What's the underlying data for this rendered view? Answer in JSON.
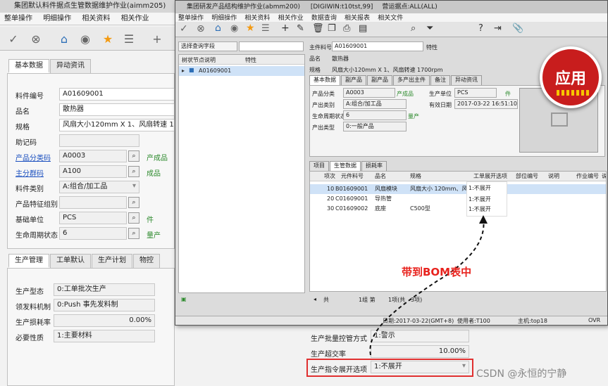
{
  "back": {
    "title": "集团默认料件据点生管数据维护作业(aimm205)",
    "menu": [
      "整单操作",
      "明细操作",
      "相关资料",
      "相关作业"
    ],
    "tabs": [
      "基本数据",
      "异动资讯"
    ],
    "fields": [
      {
        "label": "料件编号",
        "value": "A01609001"
      },
      {
        "label": "品名",
        "value": "散热器"
      },
      {
        "label": "规格",
        "value": "风扇大小120mm X 1、风扇转速 17"
      },
      {
        "label": "助记码",
        "value": ""
      },
      {
        "label": "产品分类码",
        "value": "A0003",
        "extra": "产成品"
      },
      {
        "label": "主分群码",
        "value": "A100",
        "extra": "成品"
      },
      {
        "label": "料件类别",
        "value": "A:组合/加工品"
      },
      {
        "label": "产品特征组别",
        "value": ""
      },
      {
        "label": "基础单位",
        "value": "PCS",
        "extra": "件"
      },
      {
        "label": "生命周期状态",
        "value": "6",
        "extra": "量产"
      }
    ],
    "tabs2": [
      "生产管理",
      "工单默认",
      "生产计划",
      "物控"
    ],
    "prod": [
      {
        "label": "生产型态",
        "value": "0:工单批次生产"
      },
      {
        "label": "领发料机制",
        "value": "0:Push 事先发料制"
      },
      {
        "label": "生产损耗率",
        "value": "0.00%"
      },
      {
        "label": "必要性质",
        "value": "1:主要材料"
      }
    ],
    "right": [
      {
        "label": "生产批量控管方式",
        "value": "1:警示"
      },
      {
        "label": "生产超交率",
        "value": "10.00%"
      },
      {
        "label": "生产指令展开选项",
        "value": "1:不展开"
      }
    ]
  },
  "front": {
    "title": "集团研发产品结构维护作业(abmm200)",
    "info": "[DIGIWIN:t10tst,99]",
    "site": "营运据点:ALL(ALL)",
    "menu": [
      "整单操作",
      "明细操作",
      "相关资料",
      "相关作业",
      "数据查询",
      "相关报表",
      "相关文件"
    ],
    "query": "选择查询字段",
    "tree_headers": [
      "树状节点说明",
      "特性"
    ],
    "tree_item": "A01609001",
    "main_label": "主件料号",
    "main_value": "A01609001",
    "feature_label": "特性",
    "name_label": "品名",
    "name_value": "散热器",
    "spec_label": "规格",
    "spec_value": "风扇大小120mm X 1、风扇转速 1700rpm",
    "tabs": [
      "基本数据",
      "副产品",
      "副产品",
      "多产出主件",
      "备注",
      "异动资讯"
    ],
    "fields": [
      {
        "label": "产品分类",
        "value": "A0003",
        "extra": "产成品"
      },
      {
        "label": "产出类别",
        "value": "A:组合/加工品"
      },
      {
        "label": "生命周期状态",
        "value": "6",
        "extra": "量产"
      },
      {
        "label": "产出类型",
        "value": "0:一般产品"
      }
    ],
    "unit_label": "生产单位",
    "unit_value": "PCS",
    "unit_extra": "件",
    "date_label": "有效日期",
    "date_value": "2017-03-22 16:51:10",
    "grid_tabs": [
      "项目",
      "生管数据",
      "损耗率"
    ],
    "grid_headers": [
      "项次",
      "元件料号",
      "品名",
      "规格",
      "工单展开选项",
      "部位编号",
      "说明",
      "作业编号",
      "说"
    ],
    "rows": [
      {
        "seq": "10",
        "item": "B01609001",
        "name": "风扇模块",
        "spec": "风扇大小 120mm、风扇...",
        "opt": "1:不展开"
      },
      {
        "seq": "20",
        "item": "C01609001",
        "name": "导热管",
        "spec": "",
        "opt": "1:不展开"
      },
      {
        "seq": "30",
        "item": "C01609002",
        "name": "底座",
        "spec": "C500型",
        "opt": "1:不展开"
      }
    ],
    "pager": "共",
    "pager2": "1组 第",
    "pager3": "1项(共",
    "pager4": "3项)",
    "status": "日期:2017-03-22(GMT+8)",
    "user": "使用者:T100",
    "host": "主机:top18",
    "ovr": "OVR"
  },
  "annotation": "带到BOM表中",
  "badge": "应用",
  "watermark": "CSDN @永恒的宁静",
  "colors": {
    "annotation": "#e8231e",
    "highlight_border": "#e03030",
    "badge": "#c81d1d"
  }
}
